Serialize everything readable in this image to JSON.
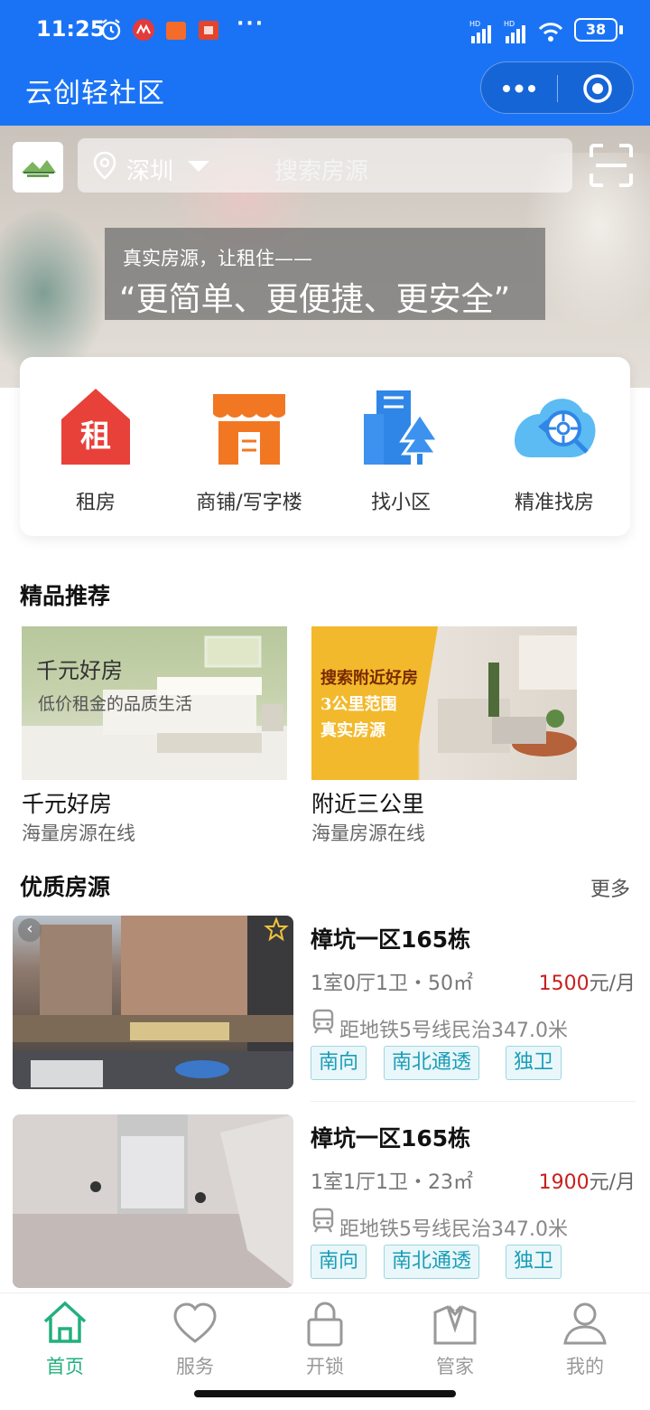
{
  "status_bar": {
    "time": "11:25",
    "battery": "38",
    "more_dots": "···"
  },
  "app": {
    "title": "云创轻社区",
    "accent": "#1a73f5"
  },
  "search": {
    "city": "深圳",
    "placeholder": "搜索房源"
  },
  "banner": {
    "line1": "真实房源，让租住——",
    "line2": "“更简单、更便捷、更安全”"
  },
  "quick_menu": [
    {
      "label": "租房",
      "icon": "rent-house-icon",
      "icon_text": "租"
    },
    {
      "label": "商铺/写字楼",
      "icon": "shop-icon"
    },
    {
      "label": "找小区",
      "icon": "community-icon"
    },
    {
      "label": "精准找房",
      "icon": "precise-search-icon"
    }
  ],
  "featured": {
    "title": "精品推荐",
    "cards": [
      {
        "name": "千元好房",
        "subtitle": "海量房源在线",
        "img_title": "千元好房",
        "img_caption": "低价租金的品质生活"
      },
      {
        "name": "附近三公里",
        "subtitle": "海量房源在线",
        "img_lines": [
          "搜索附近好房",
          "3公里范围",
          "真实房源"
        ]
      }
    ]
  },
  "listings": {
    "title": "优质房源",
    "more": "更多",
    "items": [
      {
        "name": "樟坑一区165栋",
        "layout": "1室0厅1卫・50㎡",
        "price": "1500",
        "price_unit": "元/月",
        "metro": "距地铁5号线民治347.0米",
        "tags": [
          "南向",
          "南北通透",
          "独卫"
        ]
      },
      {
        "name": "樟坑一区165栋",
        "layout": "1室1厅1卫・23㎡",
        "price": "1900",
        "price_unit": "元/月",
        "metro": "距地铁5号线民治347.0米",
        "tags": [
          "南向",
          "南北通透",
          "独卫"
        ]
      }
    ]
  },
  "tabs": [
    {
      "label": "首页",
      "icon": "home-icon",
      "active": true
    },
    {
      "label": "服务",
      "icon": "heart-icon",
      "active": false
    },
    {
      "label": "开锁",
      "icon": "lock-icon",
      "active": false
    },
    {
      "label": "管家",
      "icon": "butler-icon",
      "active": false
    },
    {
      "label": "我的",
      "icon": "profile-icon",
      "active": false
    }
  ],
  "colors": {
    "price": "#c8201e",
    "tab_active": "#22b07d",
    "tag": "#1a9db7"
  }
}
